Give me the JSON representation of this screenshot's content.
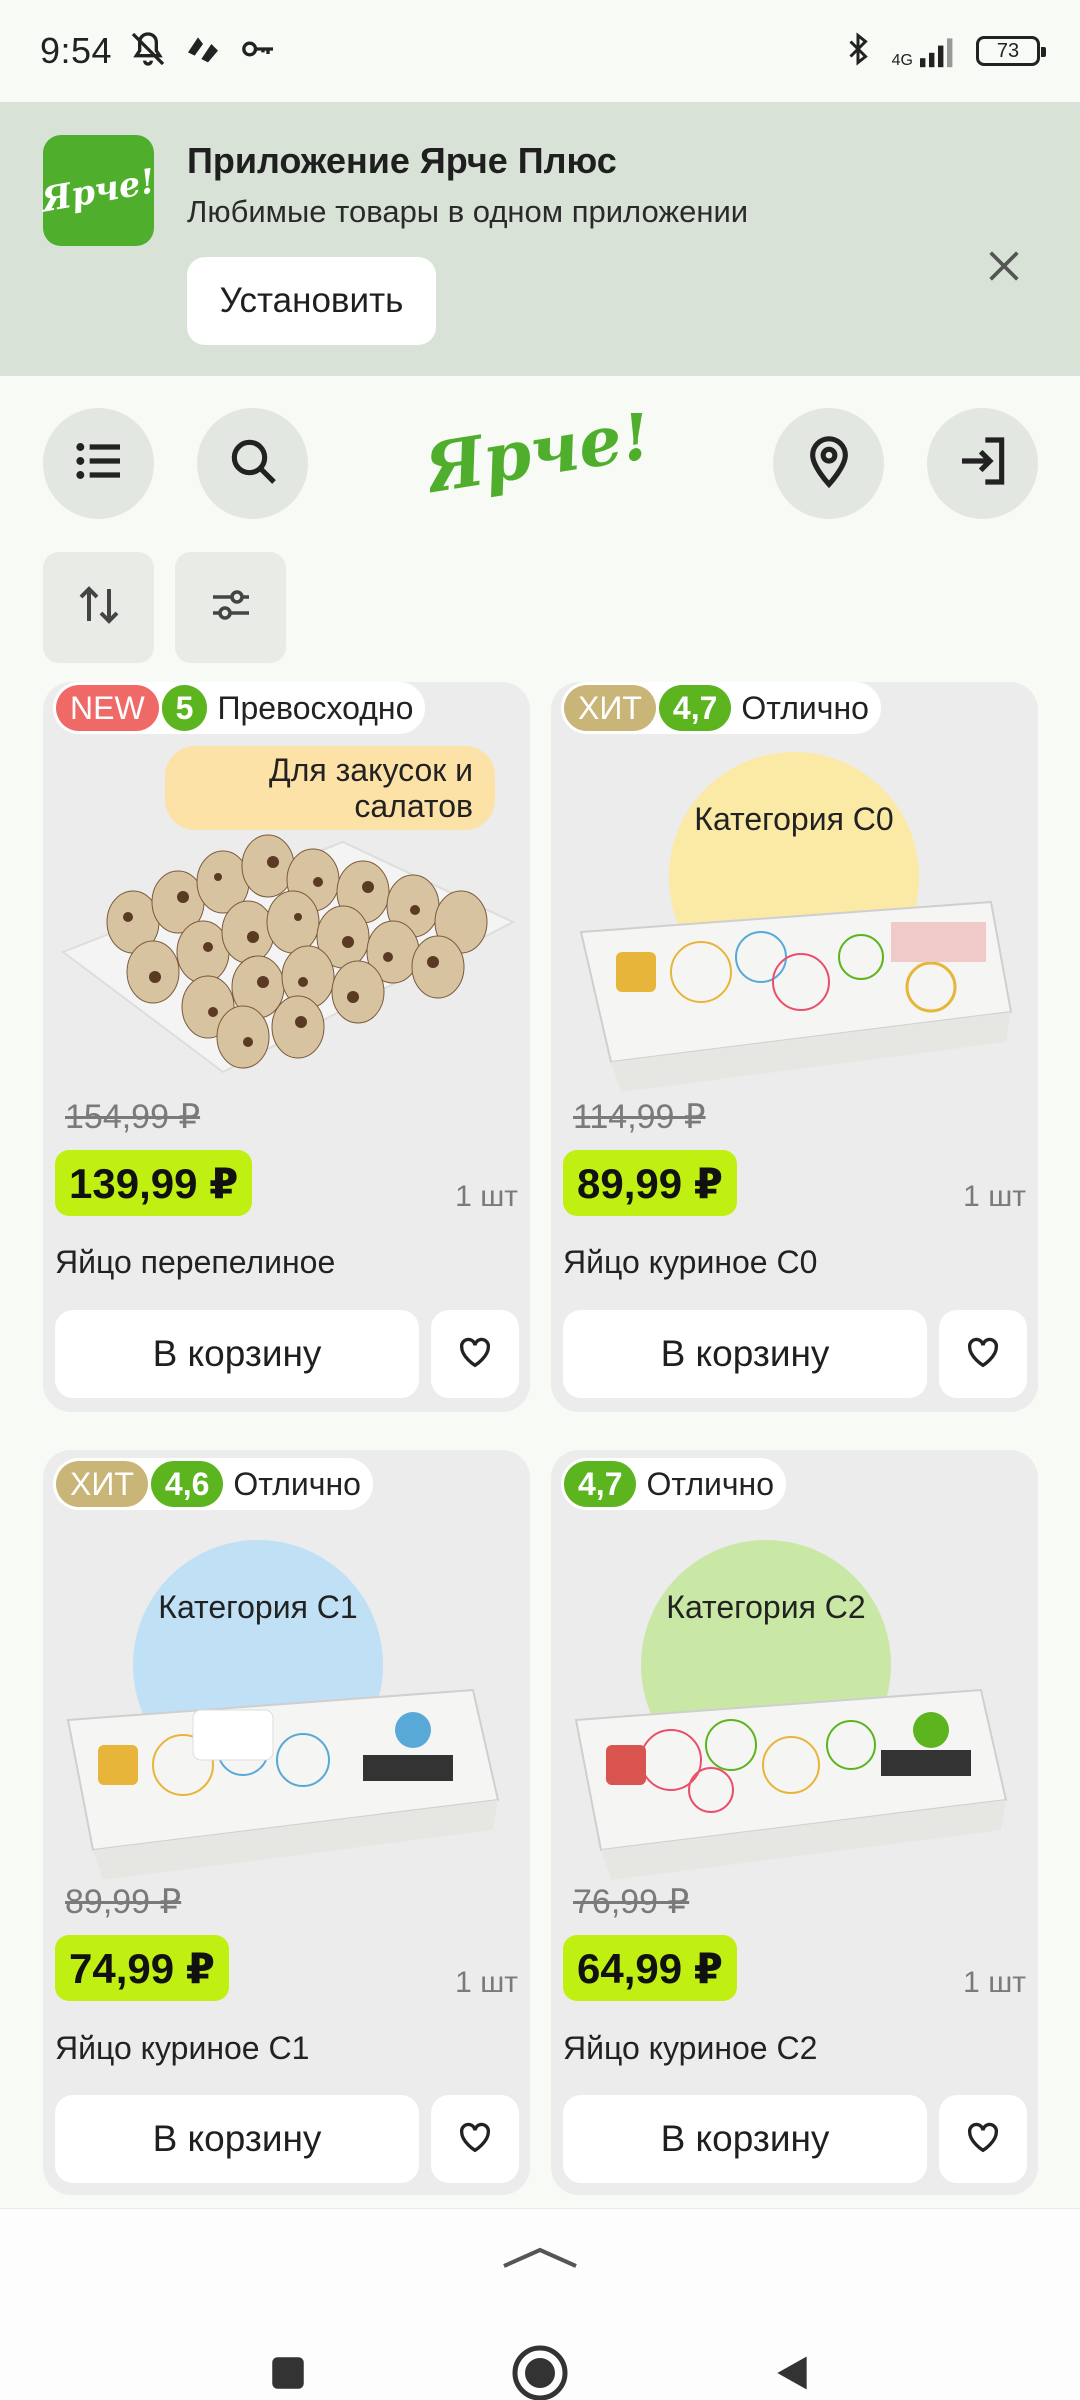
{
  "status_bar": {
    "time": "9:54",
    "network": "4G",
    "battery": "73"
  },
  "app_banner": {
    "logo_text": "Ярче!",
    "title": "Приложение Ярче Плюс",
    "subtitle": "Любимые товары в одном приложении",
    "install_label": "Установить"
  },
  "header": {
    "brand": "Ярче!"
  },
  "colors": {
    "brand_green": "#4faf2d",
    "price_highlight": "#bff011",
    "badge_new": "#ef6a67",
    "badge_hit": "#c8b577",
    "badge_rating": "#5cb51f"
  },
  "products": [
    {
      "badges": [
        "NEW"
      ],
      "rating": "5",
      "rating_text": "Превосходно",
      "promo_label": "Для закусок и салатов",
      "old_price": "154,99 ₽",
      "price": "139,99 ₽",
      "unit": "1 шт",
      "name": "Яйцо перепелиное",
      "cart_label": "В корзину"
    },
    {
      "badges": [
        "ХИТ"
      ],
      "rating": "4,7",
      "rating_text": "Отлично",
      "category_label": "Категория С0",
      "old_price": "114,99 ₽",
      "price": "89,99 ₽",
      "unit": "1 шт",
      "name": "Яйцо куриное С0",
      "cart_label": "В корзину"
    },
    {
      "badges": [
        "ХИТ"
      ],
      "rating": "4,6",
      "rating_text": "Отлично",
      "category_label": "Категория С1",
      "old_price": "89,99 ₽",
      "price": "74,99 ₽",
      "unit": "1 шт",
      "name": "Яйцо куриное С1",
      "cart_label": "В корзину"
    },
    {
      "badges": [],
      "rating": "4,7",
      "rating_text": "Отлично",
      "category_label": "Категория С2",
      "old_price": "76,99 ₽",
      "price": "64,99 ₽",
      "unit": "1 шт",
      "name": "Яйцо куриное С2",
      "cart_label": "В корзину"
    }
  ]
}
